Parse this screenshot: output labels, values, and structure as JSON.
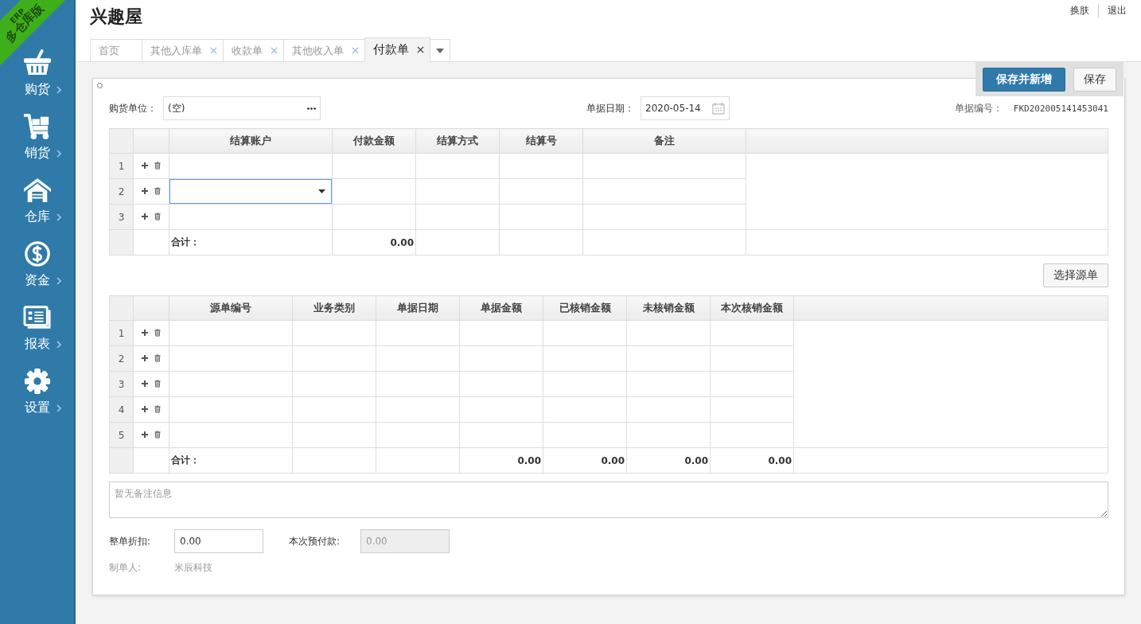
{
  "app": {
    "ribbon_top": "ERP",
    "ribbon_bottom": "多仓库版",
    "title": "兴趣屋"
  },
  "header_links": [
    "换肤",
    "退出"
  ],
  "sidebar": [
    {
      "label": "购货",
      "kind": "basket"
    },
    {
      "label": "销货",
      "kind": "cart"
    },
    {
      "label": "仓库",
      "kind": "house"
    },
    {
      "label": "资金",
      "kind": "dollar"
    },
    {
      "label": "报表",
      "kind": "report"
    },
    {
      "label": "设置",
      "kind": "gear"
    }
  ],
  "tabs": [
    {
      "label": "首页",
      "selected": false,
      "closable": false
    },
    {
      "label": "其他入库单",
      "selected": false,
      "closable": true
    },
    {
      "label": "收款单",
      "selected": false,
      "closable": true
    },
    {
      "label": "其他收入单",
      "selected": false,
      "closable": true
    },
    {
      "label": "付款单",
      "selected": true,
      "closable": true
    }
  ],
  "actions": [
    {
      "label": "保存并新增",
      "primary": true
    },
    {
      "label": "保存",
      "primary": false
    }
  ],
  "form": {
    "supplier": {
      "label": "购货单位：",
      "value": "(空)"
    },
    "date": {
      "label": "单据日期：",
      "value": "2020-05-14"
    },
    "number": {
      "label": "单据编号：",
      "value": "FKD202005141453041"
    }
  },
  "payments": {
    "columns": [
      {
        "title": "结算账户",
        "kind": "wide"
      },
      {
        "title": "付款金额",
        "total": "0.00"
      },
      {
        "title": "结算方式"
      },
      {
        "title": "结算号"
      },
      {
        "title": "备注",
        "kind": "wide"
      }
    ],
    "rows": [
      {
        "index": "1",
        "editing": false
      },
      {
        "index": "2",
        "editing": true
      },
      {
        "index": "3",
        "editing": false
      }
    ],
    "total_label": "合计："
  },
  "select_source_button": "选择源单",
  "sources": {
    "columns": [
      {
        "title": "源单编号",
        "kind": "medium"
      },
      {
        "title": "业务类别"
      },
      {
        "title": "单据日期"
      },
      {
        "title": "单据金额",
        "total": "0.00"
      },
      {
        "title": "已核销金额",
        "total": "0.00"
      },
      {
        "title": "未核销金额",
        "total": "0.00"
      },
      {
        "title": "本次核销金额",
        "total": "0.00"
      }
    ],
    "rows": [
      {
        "index": "1",
        "editing": false
      },
      {
        "index": "2",
        "editing": false
      },
      {
        "index": "3",
        "editing": false
      },
      {
        "index": "4",
        "editing": false
      },
      {
        "index": "5",
        "editing": false
      }
    ],
    "total_label": "合计："
  },
  "note": {
    "placeholder": "暂无备注信息"
  },
  "discount": {
    "label": "整单折扣:",
    "value": "0.00"
  },
  "prepay": {
    "label": "本次预付款:",
    "value": "0.00",
    "disabled": true
  },
  "maker": {
    "label": "制单人:",
    "value": "米辰科技"
  }
}
